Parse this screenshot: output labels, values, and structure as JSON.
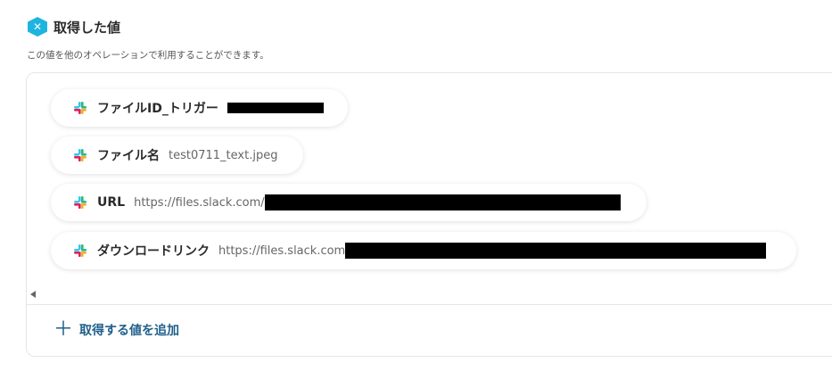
{
  "section": {
    "icon": "yoom-hex-icon",
    "title": "取得した値",
    "description": "この値を他のオペレーションで利用することができます。"
  },
  "chips": [
    {
      "label": "ファイルID_トリガー",
      "value": "",
      "icon": "slack-icon",
      "redacted": true
    },
    {
      "label": "ファイル名",
      "value": "test0711_text.jpeg",
      "icon": "slack-icon",
      "redacted": false
    },
    {
      "label": "URL",
      "value": "https://files.slack.com/",
      "icon": "slack-icon",
      "redacted": true
    },
    {
      "label": "ダウンロードリンク",
      "value": "https://files.slack.com",
      "icon": "slack-icon",
      "redacted": true
    }
  ],
  "add_button": {
    "label": "取得する値を追加",
    "icon": "plus-icon"
  },
  "colors": {
    "accent": "#1eb4e0",
    "link": "#1f5f8b",
    "border": "#e3e6ea",
    "redaction": "#000000"
  }
}
